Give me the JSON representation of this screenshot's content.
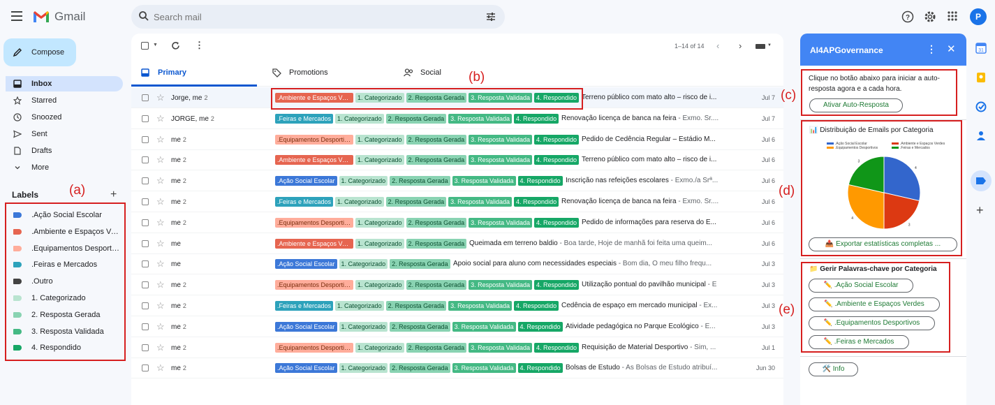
{
  "app": {
    "name": "Gmail"
  },
  "search": {
    "placeholder": "Search mail"
  },
  "avatar_letter": "P",
  "compose_label": "Compose",
  "nav": [
    {
      "label": "Inbox",
      "icon": "inbox-icon"
    },
    {
      "label": "Starred",
      "icon": "star-icon"
    },
    {
      "label": "Snoozed",
      "icon": "clock-icon"
    },
    {
      "label": "Sent",
      "icon": "send-icon"
    },
    {
      "label": "Drafts",
      "icon": "draft-icon"
    },
    {
      "label": "More",
      "icon": "chevron-down-icon"
    }
  ],
  "labels_title": "Labels",
  "labels": [
    {
      "label": ".Ação Social Escolar",
      "color": "#3c78d8"
    },
    {
      "label": ".Ambiente e Espaços Verdes",
      "color": "#e66550"
    },
    {
      "label": ".Equipamentos Desportivos",
      "color": "#ffad9b"
    },
    {
      "label": ".Feiras e Mercados",
      "color": "#2da2bb"
    },
    {
      "label": ".Outro",
      "color": "#434343"
    },
    {
      "label": "1. Categorizado",
      "color": "#b9e4d0"
    },
    {
      "label": "2. Resposta Gerada",
      "color": "#89d3b2"
    },
    {
      "label": "3. Resposta Validada",
      "color": "#44b984"
    },
    {
      "label": "4. Respondido",
      "color": "#16a766"
    }
  ],
  "toolbar": {
    "pagination": "1–14 of 14"
  },
  "tabs": [
    {
      "label": "Primary"
    },
    {
      "label": "Promotions"
    },
    {
      "label": "Social"
    }
  ],
  "status_tags": [
    "1. Categorizado",
    "2. Resposta Gerada",
    "3. Resposta Validada",
    "4. Respondido"
  ],
  "category_styles": {
    "amb": {
      "text": ".Ambiente e Espaços Ver...",
      "bg": "#e66550",
      "fg": "#ffffff"
    },
    "fei": {
      "text": ".Feiras e Mercados",
      "bg": "#2da2bb",
      "fg": "#ffffff"
    },
    "equ": {
      "text": ".Equipamentos Desportiv...",
      "bg": "#ffad9b",
      "fg": "#7a2e0e"
    },
    "aca": {
      "text": ".Ação Social Escolar",
      "bg": "#3c78d8",
      "fg": "#ffffff"
    }
  },
  "emails": [
    {
      "sender": "Jorge, me",
      "count": "2",
      "cat": "amb",
      "status": 4,
      "subject": "Terreno público com mato alto – risco de i...",
      "snippet": "",
      "date": "Jul 7"
    },
    {
      "sender": "JORGE, me",
      "count": "2",
      "cat": "fei",
      "status": 4,
      "subject": "Renovação licença de banca na feira",
      "snippet": " - Exmo. Sr....",
      "date": "Jul 7"
    },
    {
      "sender": "me",
      "count": "2",
      "cat": "equ",
      "status": 4,
      "subject": "Pedido de Cedência Regular – Estádio M...",
      "snippet": "",
      "date": "Jul 6"
    },
    {
      "sender": "me",
      "count": "2",
      "cat": "amb",
      "status": 4,
      "subject": "Terreno público com mato alto – risco de i...",
      "snippet": "",
      "date": "Jul 6"
    },
    {
      "sender": "me",
      "count": "2",
      "cat": "aca",
      "status": 4,
      "subject": "Inscrição nas refeições escolares",
      "snippet": " - Exmo./a Srª...",
      "date": "Jul 6"
    },
    {
      "sender": "me",
      "count": "2",
      "cat": "fei",
      "status": 4,
      "subject": "Renovação licença de banca na feira",
      "snippet": " - Exmo. Sr....",
      "date": "Jul 6"
    },
    {
      "sender": "me",
      "count": "2",
      "cat": "equ",
      "status": 4,
      "subject": "Pedido de informações para reserva do E...",
      "snippet": "",
      "date": "Jul 6"
    },
    {
      "sender": "me",
      "count": "",
      "cat": "amb",
      "status": 2,
      "subject": "Queimada em terreno baldio",
      "snippet": " - Boa tarde, Hoje de manhã foi feita uma queim...",
      "date": "Jul 6"
    },
    {
      "sender": "me",
      "count": "",
      "cat": "aca",
      "status": 2,
      "subject": "Apoio social para aluno com necessidades especiais",
      "snippet": " - Bom dia, O meu filho frequ...",
      "date": "Jul 3"
    },
    {
      "sender": "me",
      "count": "2",
      "cat": "equ",
      "status": 4,
      "subject": "Utilização pontual do pavilhão municipal",
      "snippet": " - E",
      "date": "Jul 3"
    },
    {
      "sender": "me",
      "count": "2",
      "cat": "fei",
      "status": 4,
      "subject": "Cedência de espaço em mercado municipal",
      "snippet": " - Ex...",
      "date": "Jul 3"
    },
    {
      "sender": "me",
      "count": "2",
      "cat": "aca",
      "status": 4,
      "subject": "Atividade pedagógica no Parque Ecológico",
      "snippet": " - E...",
      "date": "Jul 3"
    },
    {
      "sender": "me",
      "count": "2",
      "cat": "equ",
      "status": 4,
      "subject": "Requisição de Material Desportivo",
      "snippet": " - Sim, ...",
      "date": "Jul 1"
    },
    {
      "sender": "me",
      "count": "2",
      "cat": "aca",
      "status": 4,
      "subject": "Bolsas de Estudo",
      "snippet": " - As Bolsas de Estudo atribuí...",
      "date": "Jun 30"
    }
  ],
  "side_panel": {
    "title": "AI4APGovernance",
    "intro": "Clique no botão abaixo para iniciar a auto-resposta agora e a cada hora.",
    "auto_button": "Ativar Auto-Resposta",
    "chart_title": "📊 Distribuição de Emails por Categoria",
    "export_button": "📤 Exportar estatísticas completas ...",
    "keywords_title": "📁 Gerir Palavras-chave por Categoria",
    "keyword_buttons": [
      "✏️ .Ação Social Escolar",
      "✏️ .Ambiente e Espaços Verdes",
      "✏️ .Equipamentos Desportivos",
      "✏️ .Feiras e Mercados"
    ],
    "info_button": "🛠️ Info"
  },
  "chart_data": {
    "type": "pie",
    "title": "",
    "labels": [
      ".Ação Social Escolar",
      ".Ambiente e Espaços Verdes",
      ".Equipamentos Desportivos",
      ".Feiras e Mercados"
    ],
    "values": [
      4,
      3,
      4,
      3
    ],
    "colors": [
      "#3366cc",
      "#dc3912",
      "#ff9900",
      "#109618"
    ],
    "legend": "top"
  },
  "annotations": [
    "(a)",
    "(b)",
    "(c)",
    "(d)",
    "(e)"
  ]
}
